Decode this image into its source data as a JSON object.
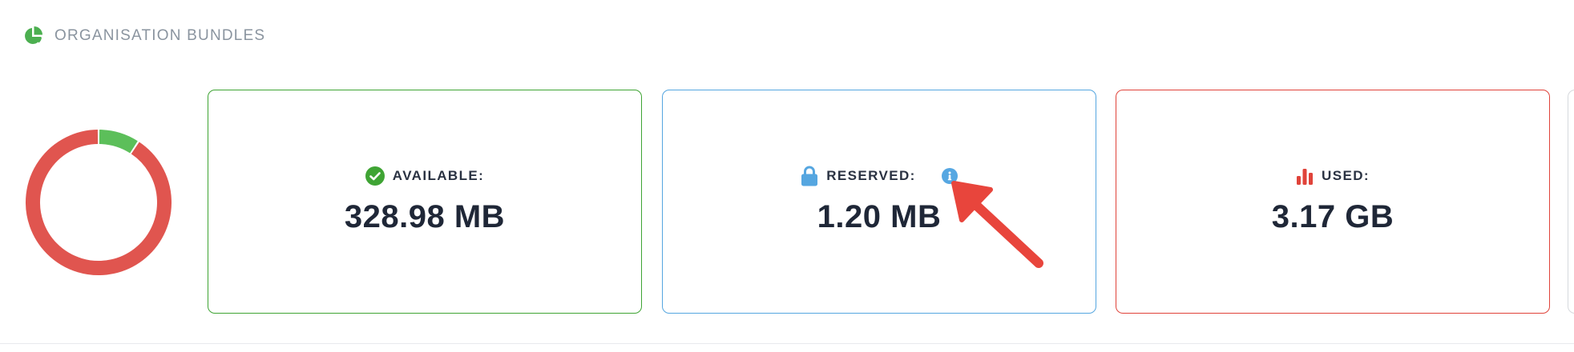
{
  "header": {
    "title": "ORGANISATION BUNDLES",
    "icon": "pie-chart-icon"
  },
  "donut": {
    "segments": [
      {
        "name": "Available",
        "value_mb": 328.98,
        "color": "#5cbf5a"
      },
      {
        "name": "Reserved",
        "value_mb": 1.2,
        "color": "#55a6e0"
      },
      {
        "name": "Used",
        "value_mb": 3246.08,
        "color": "#e0554f"
      }
    ]
  },
  "cards": {
    "available": {
      "label": "AVAILABLE:",
      "value": "328.98 MB",
      "icon": "check-circle-icon",
      "color": "#3fa434"
    },
    "reserved": {
      "label": "RESERVED:",
      "value": "1.20 MB",
      "icon": "lock-icon",
      "info_icon": "info-icon",
      "color": "#55a6e0"
    },
    "used": {
      "label": "USED:",
      "value": "3.17 GB",
      "icon": "bar-chart-icon",
      "color": "#e0433a"
    }
  },
  "annotation": {
    "icon": "red-arrow-icon",
    "color": "#e8453c"
  }
}
